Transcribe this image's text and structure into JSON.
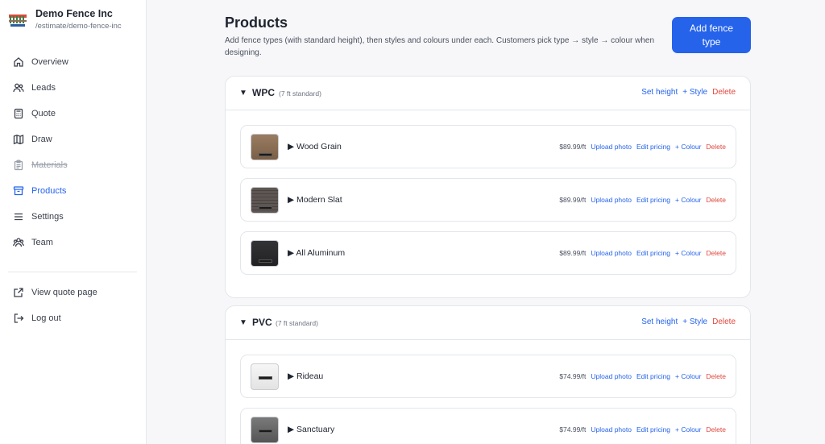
{
  "brand": {
    "name": "Demo Fence Inc",
    "slug": "/estimate/demo-fence-inc"
  },
  "nav": {
    "items": [
      {
        "label": "Overview",
        "icon": "home-icon"
      },
      {
        "label": "Leads",
        "icon": "users-icon"
      },
      {
        "label": "Quote",
        "icon": "calculator-icon"
      },
      {
        "label": "Draw",
        "icon": "map-icon"
      },
      {
        "label": "Materials",
        "icon": "clipboard-icon"
      },
      {
        "label": "Products",
        "icon": "archive-icon"
      },
      {
        "label": "Settings",
        "icon": "menu-icon"
      },
      {
        "label": "Team",
        "icon": "team-icon"
      }
    ],
    "secondary": [
      {
        "label": "View quote page",
        "icon": "external-link-icon"
      },
      {
        "label": "Log out",
        "icon": "logout-icon"
      }
    ]
  },
  "page": {
    "title": "Products",
    "description": "Add fence types (with standard height), then styles and colours under each. Customers pick type → style → colour when designing.",
    "add_button": "Add fence type"
  },
  "labels": {
    "set_height": "Set height",
    "add_style": "+ Style",
    "delete": "Delete",
    "upload_photo": "Upload photo",
    "edit_pricing": "Edit pricing",
    "add_colour": "+ Colour",
    "caret_open": "▼",
    "caret_closed": "▶"
  },
  "types": [
    {
      "name": "WPC",
      "height": "(7 ft standard)",
      "styles": [
        {
          "name": "Wood Grain",
          "price": "$89.99/ft",
          "swatch": "#8a6f55"
        },
        {
          "name": "Modern Slat",
          "price": "$89.99/ft",
          "swatch": "#5b5450"
        },
        {
          "name": "All Aluminum",
          "price": "$89.99/ft",
          "swatch": "#2b2b2d"
        }
      ]
    },
    {
      "name": "PVC",
      "height": "(7 ft standard)",
      "styles": [
        {
          "name": "Rideau",
          "price": "$74.99/ft",
          "swatch": "#f1f1f1"
        },
        {
          "name": "Sanctuary",
          "price": "$74.99/ft",
          "swatch": "#6a6a6a"
        }
      ]
    }
  ],
  "colors": {
    "accent": "#2563eb",
    "danger": "#e0463c"
  }
}
